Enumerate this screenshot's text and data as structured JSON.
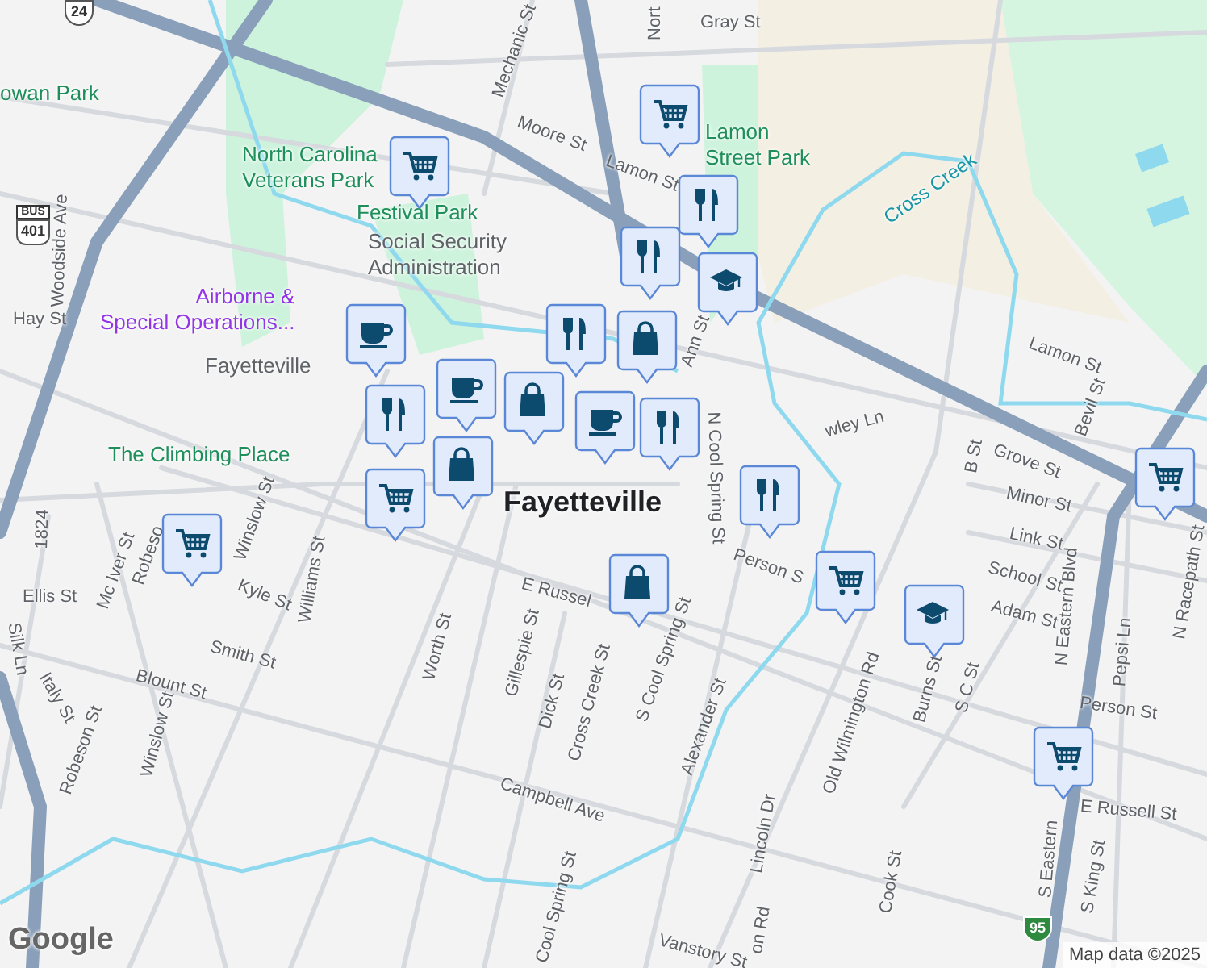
{
  "map": {
    "labels": [
      {
        "kind": "park",
        "text": "owan Park"
      },
      {
        "kind": "park",
        "lines": [
          "North Carolina",
          "Veterans Park"
        ]
      },
      {
        "kind": "park",
        "text": "Festival Park"
      },
      {
        "kind": "place",
        "lines": [
          "Social Security",
          "Administration"
        ]
      },
      {
        "kind": "street",
        "text": "Hay St"
      },
      {
        "kind": "poi",
        "lines": [
          "Airborne &",
          "Special Operations..."
        ]
      },
      {
        "kind": "place",
        "text": "Fayetteville"
      },
      {
        "kind": "park",
        "text": "The Climbing Place"
      },
      {
        "kind": "town",
        "text": "Fayetteville"
      },
      {
        "kind": "street",
        "text": "Mechanic St"
      },
      {
        "kind": "street",
        "text": "Moore St"
      },
      {
        "kind": "street",
        "text": "Gray St"
      },
      {
        "kind": "street",
        "text": "Lamon St"
      },
      {
        "kind": "park",
        "lines": [
          "Lamon",
          "Street Park"
        ]
      },
      {
        "kind": "water",
        "text": "Cross Creek"
      },
      {
        "kind": "street",
        "text": "Ann St"
      },
      {
        "kind": "street",
        "text": "N Cool Spring St"
      },
      {
        "kind": "street",
        "text": "Lamon St"
      },
      {
        "kind": "street",
        "text": "Bevil St"
      },
      {
        "kind": "street",
        "text": "Grove St"
      },
      {
        "kind": "street",
        "text": "B St"
      },
      {
        "kind": "street",
        "text": "Woodside Ave"
      },
      {
        "kind": "street",
        "text": "1824"
      },
      {
        "kind": "street",
        "text": "Mc Iver St"
      },
      {
        "kind": "street",
        "text": "Robeso"
      },
      {
        "kind": "street",
        "text": "Winslow St"
      },
      {
        "kind": "street",
        "text": "Kyle St"
      },
      {
        "kind": "street",
        "text": "Williams St"
      },
      {
        "kind": "street",
        "text": "Ellis St"
      },
      {
        "kind": "street",
        "text": "Smith St"
      },
      {
        "kind": "street",
        "text": "Italy St"
      },
      {
        "kind": "street",
        "text": "Blount St"
      },
      {
        "kind": "street",
        "text": "Robeson St"
      },
      {
        "kind": "street",
        "text": "Winslow St"
      },
      {
        "kind": "street",
        "text": "Worth St"
      },
      {
        "kind": "street",
        "text": "Gillespie St"
      },
      {
        "kind": "street",
        "text": "Dick St"
      },
      {
        "kind": "street",
        "text": "Cross Creek St"
      },
      {
        "kind": "street",
        "text": "E Russel"
      },
      {
        "kind": "street",
        "text": "Campbell Ave"
      },
      {
        "kind": "street",
        "text": "Cool Spring St"
      },
      {
        "kind": "street",
        "text": "Silk Ln"
      },
      {
        "kind": "street",
        "text": "Minor St"
      },
      {
        "kind": "street",
        "text": "Link St"
      },
      {
        "kind": "street",
        "text": "School St"
      },
      {
        "kind": "street",
        "text": "Adam St"
      },
      {
        "kind": "street",
        "text": "Person S"
      },
      {
        "kind": "street",
        "text": "S Cool Spring St"
      },
      {
        "kind": "street",
        "text": "Alexander St"
      },
      {
        "kind": "street",
        "text": "Old Wilmington Rd"
      },
      {
        "kind": "street",
        "text": "Burns St"
      },
      {
        "kind": "street",
        "text": "S C St"
      },
      {
        "kind": "street",
        "text": "N Eastern Blvd"
      },
      {
        "kind": "street",
        "text": "Pepsi Ln"
      },
      {
        "kind": "street",
        "text": "N Racepath St"
      },
      {
        "kind": "street",
        "text": "Person St"
      },
      {
        "kind": "street",
        "text": "E Russell St"
      },
      {
        "kind": "street",
        "text": "S Eastern"
      },
      {
        "kind": "street",
        "text": "Lincoln Dr"
      },
      {
        "kind": "street",
        "text": "Cook St"
      },
      {
        "kind": "street",
        "text": "S King St"
      },
      {
        "kind": "street",
        "text": "Vanstory St"
      },
      {
        "kind": "street",
        "text": "on Rd"
      },
      {
        "kind": "street",
        "text": "wley Ln"
      },
      {
        "kind": "street",
        "text": "Nort"
      }
    ],
    "shields": [
      {
        "kind": "state",
        "text": "24"
      },
      {
        "kind": "bus",
        "text": "401",
        "tag": "BUS"
      },
      {
        "kind": "interstate",
        "text": "95"
      }
    ],
    "markers": [
      {
        "kind": "cart"
      },
      {
        "kind": "cart"
      },
      {
        "kind": "fork"
      },
      {
        "kind": "fork"
      },
      {
        "kind": "cap"
      },
      {
        "kind": "bag"
      },
      {
        "kind": "fork"
      },
      {
        "kind": "cup"
      },
      {
        "kind": "fork"
      },
      {
        "kind": "cup"
      },
      {
        "kind": "bag"
      },
      {
        "kind": "cup"
      },
      {
        "kind": "fork"
      },
      {
        "kind": "cart"
      },
      {
        "kind": "bag"
      },
      {
        "kind": "cart"
      },
      {
        "kind": "fork"
      },
      {
        "kind": "bag"
      },
      {
        "kind": "cart"
      },
      {
        "kind": "cap"
      },
      {
        "kind": "cart"
      },
      {
        "kind": "cart"
      }
    ],
    "attribution": "Map data ©2025",
    "logo": "Google"
  }
}
